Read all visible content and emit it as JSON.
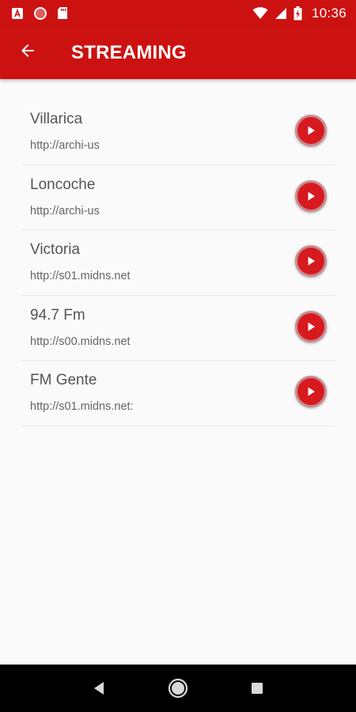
{
  "status_bar": {
    "time": "10:36",
    "icons_left": [
      "pdf-icon",
      "record-icon",
      "sd-card-icon"
    ],
    "icons_right": [
      "wifi-icon",
      "signal-icon",
      "battery-icon"
    ]
  },
  "app_bar": {
    "title": "STREAMING",
    "back_icon": "arrow-back-icon"
  },
  "stations": [
    {
      "name": "Villarica",
      "url": "http://archi-us"
    },
    {
      "name": "Loncoche",
      "url": "http://archi-us"
    },
    {
      "name": "Victoria",
      "url": "http://s01.midns.net"
    },
    {
      "name": "94.7 Fm",
      "url": "http://s00.midns.net"
    },
    {
      "name": "FM Gente",
      "url": "http://s01.midns.net:"
    }
  ],
  "nav_bar": {
    "icons": [
      "back-triangle-icon",
      "home-circle-icon",
      "recents-square-icon"
    ]
  },
  "colors": {
    "primary": "#cc1111",
    "play_button": "#d71920",
    "background": "#fafafa"
  }
}
